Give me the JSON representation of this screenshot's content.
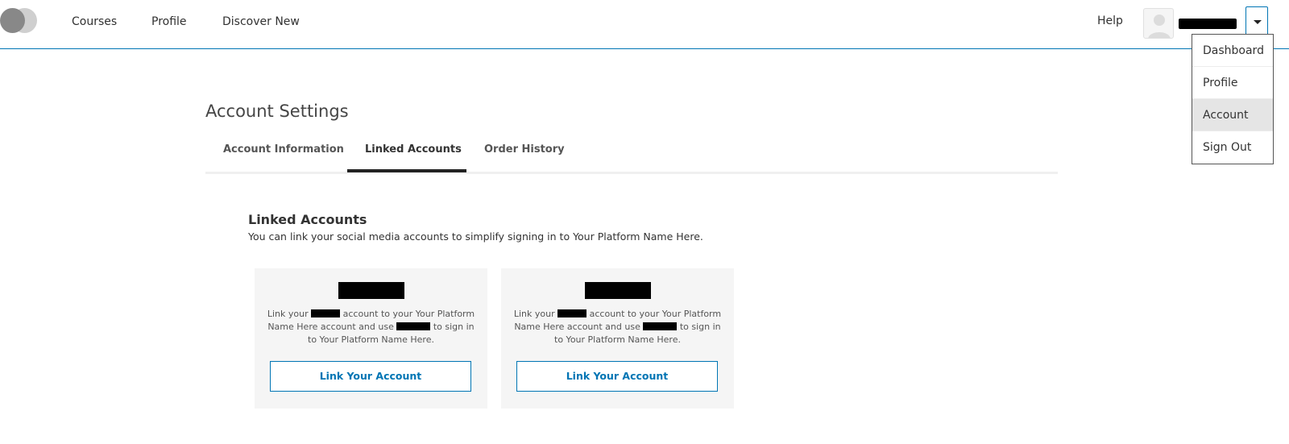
{
  "header": {
    "nav": {
      "courses": "Courses",
      "profile": "Profile",
      "discover": "Discover New"
    },
    "help": "Help",
    "user_menu": {
      "items": [
        "Dashboard",
        "Profile",
        "Account",
        "Sign Out"
      ],
      "active": "Account"
    }
  },
  "main": {
    "page_title": "Account Settings",
    "tabs": [
      "Account Information",
      "Linked Accounts",
      "Order History"
    ],
    "active_tab": "Linked Accounts",
    "section": {
      "title": "Linked Accounts",
      "description": "You can link your social media accounts to simplify signing in to Your Platform Name Here."
    },
    "cards": [
      {
        "text_part1": "Link your",
        "text_part2": "account to your Your Platform Name Here account and use",
        "text_part3": "to sign in to Your Platform Name Here.",
        "button": "Link Your Account"
      },
      {
        "text_part1": "Link your",
        "text_part2": "account to your Your Platform Name Here account and use",
        "text_part3": "to sign in to Your Platform Name Here.",
        "button": "Link Your Account"
      }
    ]
  },
  "colors": {
    "accent": "#0075b4",
    "active_menu_bg": "#e5e5e5",
    "card_bg": "#f5f5f5"
  },
  "icons": [
    "logo-icon",
    "avatar-icon",
    "caret-down-icon"
  ]
}
